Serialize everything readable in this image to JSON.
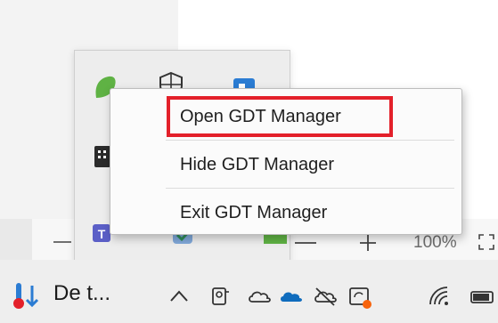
{
  "context_menu": {
    "items": [
      {
        "label": "Open GDT Manager",
        "highlighted": true
      },
      {
        "label": "Hide GDT Manager"
      },
      {
        "label": "Exit GDT Manager"
      }
    ],
    "highlight_color": "#e3202a"
  },
  "zoom": {
    "level": "100%"
  },
  "taskbar": {
    "app_label": "De t...",
    "tray_icons": [
      "chevron-up-icon",
      "webcam-icon",
      "onedrive-icon",
      "onedrive-blue-icon",
      "cloud-off-icon",
      "sync-status-icon",
      "wifi-icon",
      "battery-icon"
    ]
  },
  "tray_flyout": {
    "icons": [
      "green-leaf-icon",
      "shield-icon",
      "blue-app-icon",
      "keyboard-app-icon",
      "teams-icon",
      "check-badge-icon",
      "green-app-icon"
    ]
  },
  "colors": {
    "accent_blue": "#2b7cd3",
    "onedrive_blue": "#0f6cbd",
    "green": "#5fb244",
    "teams_purple": "#5b5fc7",
    "notification_orange": "#f7630c"
  }
}
